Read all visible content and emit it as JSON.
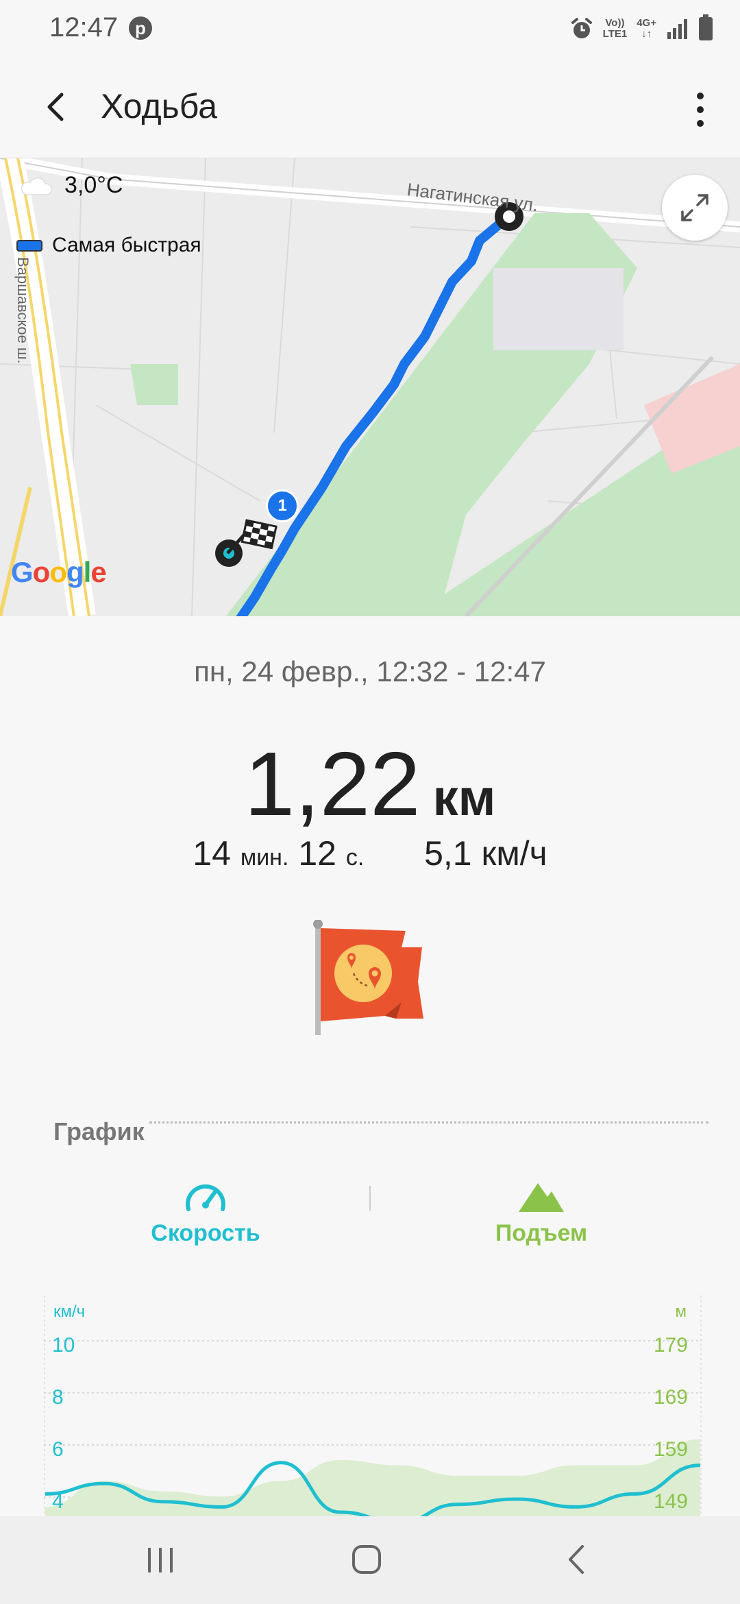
{
  "status_bar": {
    "time": "12:47",
    "network_top": "Vo))",
    "network_bottom": "LTE1",
    "network2_top": "4G+",
    "network2_bottom": "↓↑"
  },
  "app_bar": {
    "title": "Ходьба"
  },
  "map": {
    "temperature": "3,0°C",
    "route_label": "Самая быстрая",
    "street_1": "Нагатинская ул.",
    "street_2": "Варшавское ш.",
    "google": [
      "G",
      "o",
      "o",
      "g",
      "l",
      "e"
    ],
    "google_colors": [
      "#4285F4",
      "#EA4335",
      "#FBBC05",
      "#4285F4",
      "#34A853",
      "#EA4335"
    ],
    "marker_number": "1",
    "route_color": "#1a73e8"
  },
  "summary": {
    "date_range": "пн, 24 февр., 12:32 - 12:47",
    "distance_value": "1,22",
    "distance_unit": "км",
    "duration_min": "14",
    "duration_min_unit": "мин.",
    "duration_sec": "12",
    "duration_sec_unit": "с.",
    "speed": "5,1 км/ч"
  },
  "graph": {
    "header": "График",
    "tabs": [
      {
        "label": "Скорость",
        "icon": "speedometer-icon",
        "color": "#1fbfd0"
      },
      {
        "label": "Подъем",
        "icon": "mountain-icon",
        "color": "#8bc34a"
      }
    ],
    "left_unit": "км/ч",
    "right_unit": "м",
    "left_ticks": [
      "10",
      "8",
      "6",
      "4"
    ],
    "right_ticks": [
      "179",
      "169",
      "159",
      "149"
    ]
  },
  "chart_data": {
    "type": "line",
    "x": [
      0,
      0.09,
      0.18,
      0.27,
      0.36,
      0.45,
      0.54,
      0.63,
      0.72,
      0.81,
      0.9,
      1.0
    ],
    "series": [
      {
        "values": [
          3.7,
          4.1,
          3.4,
          3.2,
          4.9,
          3.0,
          2.6,
          3.3,
          3.5,
          3.2,
          3.7,
          4.8
        ]
      },
      {
        "values": [
          145,
          150,
          148,
          147,
          150,
          154,
          153,
          151,
          151,
          153,
          153,
          158
        ]
      }
    ],
    "ylim_left": [
      4,
      10
    ],
    "ylim_right": [
      149,
      179
    ]
  }
}
